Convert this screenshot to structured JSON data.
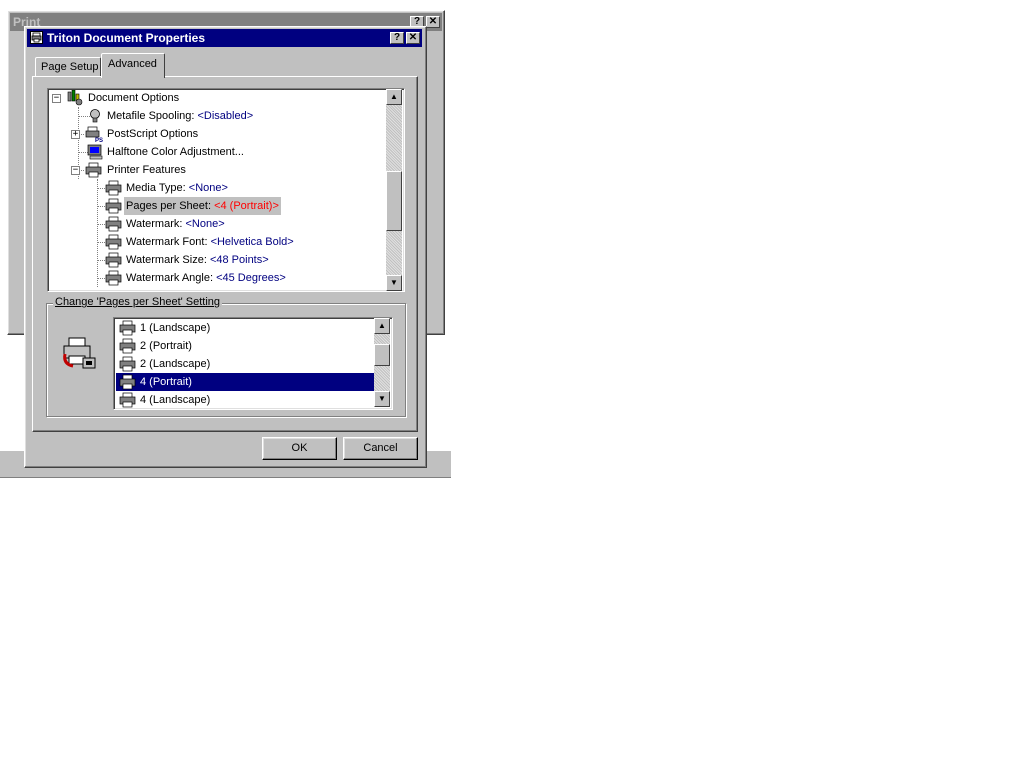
{
  "background_window": {
    "title": "Print",
    "help_btn": "?",
    "close_btn": "✕"
  },
  "dialog": {
    "title": "Triton Document Properties",
    "help_btn": "?",
    "close_btn": "✕",
    "tabs": [
      {
        "label": "Page Setup",
        "active": false
      },
      {
        "label": "Advanced",
        "active": true
      }
    ],
    "tree": {
      "items": [
        {
          "label": "Document Options",
          "value": ""
        },
        {
          "label": "Metafile Spooling: ",
          "value": "<Disabled>"
        },
        {
          "label": "PostScript Options",
          "value": ""
        },
        {
          "label": "Halftone Color Adjustment...",
          "value": ""
        },
        {
          "label": "Printer Features",
          "value": ""
        },
        {
          "label": "Media Type: ",
          "value": "<None>"
        },
        {
          "label": "Pages per Sheet: ",
          "value": "<4 (Portrait)>"
        },
        {
          "label": "Watermark: ",
          "value": "<None>"
        },
        {
          "label": "Watermark Font: ",
          "value": "<Helvetica Bold>"
        },
        {
          "label": "Watermark Size: ",
          "value": "<48 Points>"
        },
        {
          "label": "Watermark Angle: ",
          "value": "<45 Degrees>"
        }
      ],
      "collapse_sign": "−",
      "expand_sign": "+"
    },
    "setting_group": {
      "label": "Change 'Pages per Sheet' Setting",
      "options": [
        {
          "label": "1 (Landscape)",
          "selected": false
        },
        {
          "label": "2 (Portrait)",
          "selected": false
        },
        {
          "label": "2 (Landscape)",
          "selected": false
        },
        {
          "label": "4 (Portrait)",
          "selected": true
        },
        {
          "label": "4 (Landscape)",
          "selected": false
        }
      ]
    },
    "buttons": {
      "ok": "OK",
      "cancel": "Cancel"
    },
    "colors": {
      "title_bar": "#000080",
      "selection": "#000080",
      "value_text": "#000080",
      "highlight_value": "#ff0000",
      "face": "#c0c0c0"
    },
    "icons": {
      "title": "printer-icon",
      "tree_root": "document-options-icon",
      "metafile": "lightbulb-icon",
      "halftone": "monitor-icon",
      "setting": "printer-setting-icon"
    }
  }
}
